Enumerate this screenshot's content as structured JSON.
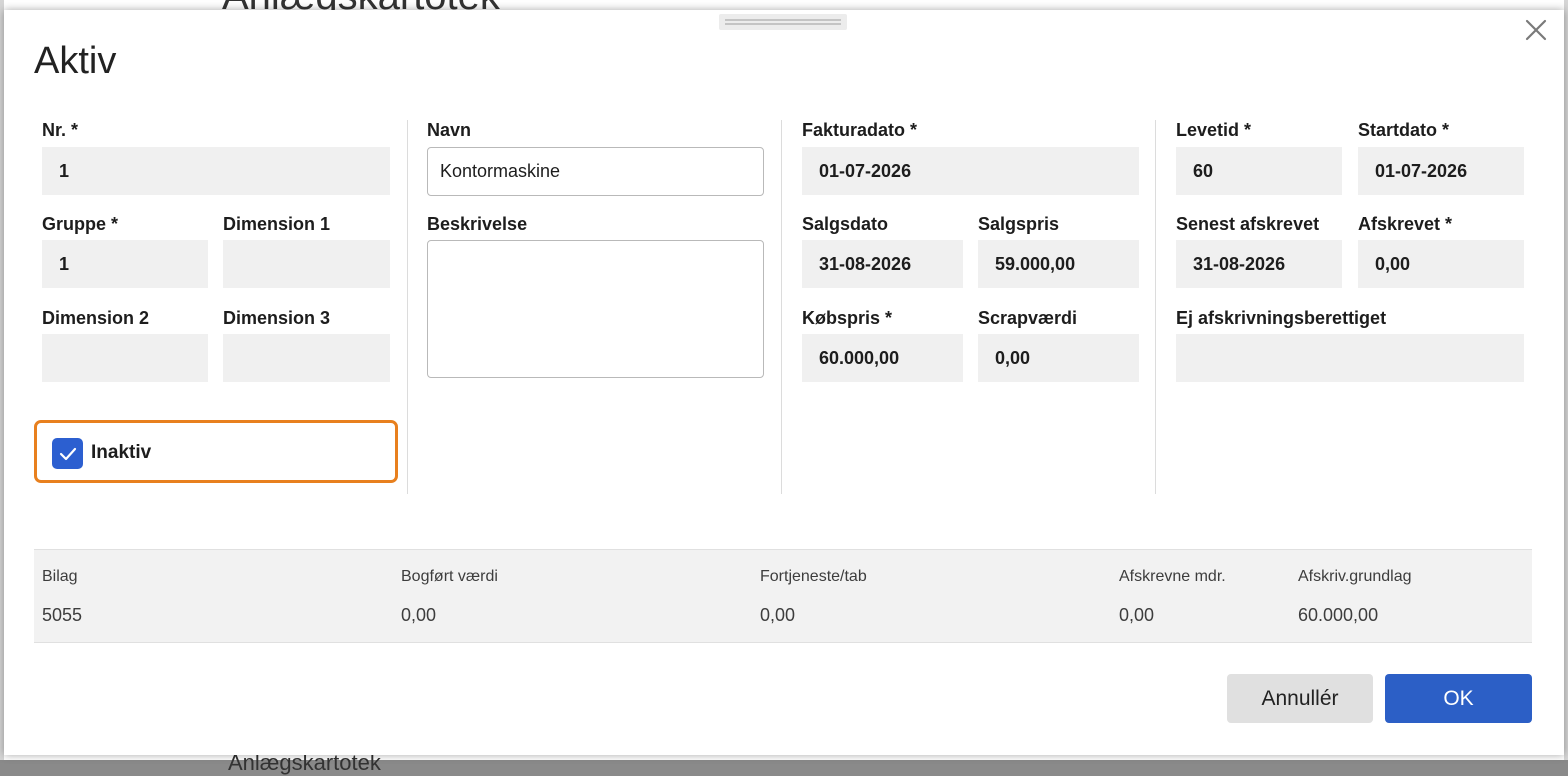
{
  "background": {
    "title": "Anlægskartotek",
    "bottom_text": "Anlægskartotek"
  },
  "dialog": {
    "title": "Aktiv",
    "close_icon": "close-icon",
    "fields": {
      "nr": {
        "label": "Nr. *",
        "value": "1"
      },
      "gruppe": {
        "label": "Gruppe *",
        "value": "1"
      },
      "dimension1": {
        "label": "Dimension 1",
        "value": ""
      },
      "dimension2": {
        "label": "Dimension 2",
        "value": ""
      },
      "dimension3": {
        "label": "Dimension 3",
        "value": ""
      },
      "navn": {
        "label": "Navn",
        "value": "Kontormaskine"
      },
      "beskrivelse": {
        "label": "Beskrivelse",
        "value": ""
      },
      "fakturadato": {
        "label": "Fakturadato *",
        "value": "01-07-2026"
      },
      "salgsdato": {
        "label": "Salgsdato",
        "value": "31-08-2026"
      },
      "salgspris": {
        "label": "Salgspris",
        "value": "59.000,00"
      },
      "kobspris": {
        "label": "Købspris *",
        "value": "60.000,00"
      },
      "scrapvaerdi": {
        "label": "Scrapværdi",
        "value": "0,00"
      },
      "levetid": {
        "label": "Levetid *",
        "value": "60"
      },
      "startdato": {
        "label": "Startdato *",
        "value": "01-07-2026"
      },
      "senest_afskrevet": {
        "label": "Senest afskrevet",
        "value": "31-08-2026"
      },
      "afskrevet": {
        "label": "Afskrevet *",
        "value": "0,00"
      },
      "ej_afskrivningsberettiget": {
        "label": "Ej afskrivningsberettiget",
        "value": ""
      }
    },
    "inaktiv": {
      "label": "Inaktiv",
      "checked": true,
      "check_icon": "checkmark-icon"
    },
    "summary": {
      "headers": [
        "Bilag",
        "Bogført værdi",
        "Fortjeneste/tab",
        "Afskrevne mdr.",
        "Afskriv.grundlag"
      ],
      "values": [
        "5055",
        "0,00",
        "0,00",
        "0,00",
        "60.000,00"
      ]
    },
    "buttons": {
      "cancel": "Annullér",
      "ok": "OK"
    }
  },
  "colors": {
    "primary": "#2c5fc6",
    "highlight_border": "#e8801e",
    "readonly_bg": "#f0f0f0"
  }
}
